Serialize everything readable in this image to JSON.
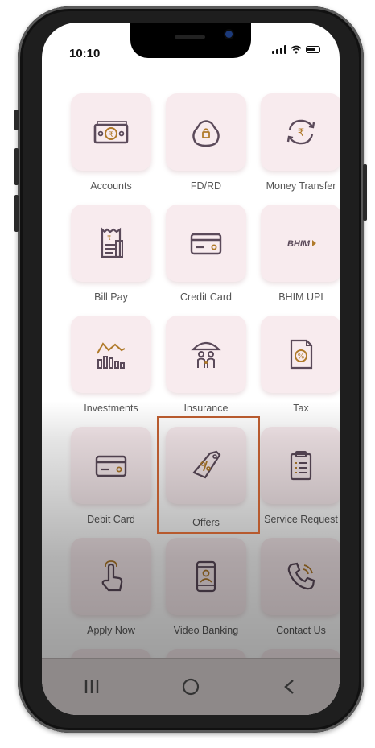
{
  "status": {
    "time": "10:10"
  },
  "tiles": [
    {
      "label": "Accounts",
      "icon": "money-icon"
    },
    {
      "label": "FD/RD",
      "icon": "money-bag-icon"
    },
    {
      "label": "Money Transfer",
      "icon": "rupee-transfer-icon"
    },
    {
      "label": "Bill Pay",
      "icon": "receipt-icon"
    },
    {
      "label": "Credit Card",
      "icon": "credit-card-icon"
    },
    {
      "label": "BHIM UPI",
      "icon": "bhim-logo",
      "logo_text": "BHIM"
    },
    {
      "label": "Investments",
      "icon": "investment-chart-icon"
    },
    {
      "label": "Insurance",
      "icon": "umbrella-family-icon"
    },
    {
      "label": "Tax",
      "icon": "tax-document-icon"
    },
    {
      "label": "Debit Card",
      "icon": "debit-card-icon"
    },
    {
      "label": "Offers",
      "icon": "offer-tag-icon"
    },
    {
      "label": "Service Request",
      "icon": "clipboard-icon"
    },
    {
      "label": "Apply Now",
      "icon": "tap-hand-icon"
    },
    {
      "label": "Video Banking",
      "icon": "video-phone-icon"
    },
    {
      "label": "Contact Us",
      "icon": "phone-call-icon"
    }
  ],
  "highlighted_tile": "Offers",
  "colors": {
    "accent": "#b75a2e",
    "icon_stroke": "#5b4a5a",
    "icon_accent": "#b07a2a",
    "tile_bg": "#f8ebee"
  },
  "navbar": {
    "recent_icon": "recent-apps-icon",
    "home_icon": "home-circle-icon",
    "back_icon": "back-chevron-icon"
  }
}
